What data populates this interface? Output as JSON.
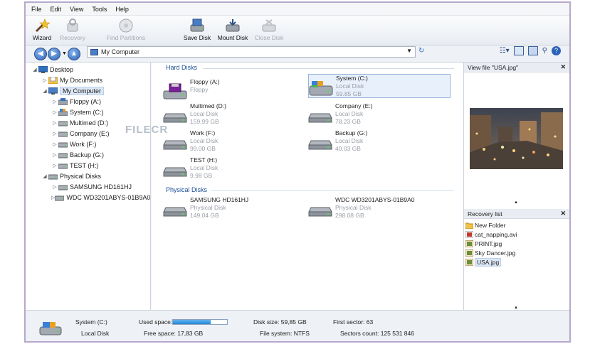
{
  "menu": [
    "File",
    "Edit",
    "View",
    "Tools",
    "Help"
  ],
  "toolbar": {
    "wizard": "Wizard",
    "recovery": "Recovery",
    "find_partitions": "Find Partitions",
    "save_disk": "Save Disk",
    "mount_disk": "Mount Disk",
    "close_disk": "Close Disk"
  },
  "address": "My Computer",
  "tree": [
    {
      "label": "Desktop",
      "level": 0,
      "expanded": true,
      "icon": "desktop-icon"
    },
    {
      "label": "My Documents",
      "level": 1,
      "expanded": false,
      "icon": "documents-icon"
    },
    {
      "label": "My Computer",
      "level": 1,
      "expanded": true,
      "icon": "computer-icon",
      "selected": true
    },
    {
      "label": "Floppy (A:)",
      "level": 2,
      "expanded": false,
      "icon": "floppy-icon"
    },
    {
      "label": "System (C:)",
      "level": 2,
      "expanded": false,
      "icon": "system-drive-icon"
    },
    {
      "label": "Multimed (D:)",
      "level": 2,
      "expanded": false,
      "icon": "drive-icon"
    },
    {
      "label": "Company (E:)",
      "level": 2,
      "expanded": false,
      "icon": "drive-icon"
    },
    {
      "label": "Work (F:)",
      "level": 2,
      "expanded": false,
      "icon": "drive-icon"
    },
    {
      "label": "Backup (G:)",
      "level": 2,
      "expanded": false,
      "icon": "drive-icon"
    },
    {
      "label": "TEST (H:)",
      "level": 2,
      "expanded": false,
      "icon": "drive-icon"
    },
    {
      "label": "Physical Disks",
      "level": 1,
      "expanded": true,
      "icon": "drive-icon"
    },
    {
      "label": "SAMSUNG HD161HJ",
      "level": 2,
      "expanded": false,
      "icon": "drive-icon"
    },
    {
      "label": "WDC WD3201ABYS-01B9A0",
      "level": 2,
      "expanded": false,
      "icon": "drive-icon"
    }
  ],
  "hard_disks_header": "Hard Disks",
  "physical_disks_header": "Physical Disks",
  "hard_disks": [
    {
      "name": "Floppy (A:)",
      "type": "Floppy",
      "size": ""
    },
    {
      "name": "System (C:)",
      "type": "Local Disk",
      "size": "59.85 GB",
      "selected": true
    },
    {
      "name": "Multimed (D:)",
      "type": "Local Disk",
      "size": "159.99 GB"
    },
    {
      "name": "Company (E:)",
      "type": "Local Disk",
      "size": "78.23 GB"
    },
    {
      "name": "Work (F:)",
      "type": "Local Disk",
      "size": "99.00 GB"
    },
    {
      "name": "Backup (G:)",
      "type": "Local Disk",
      "size": "40.03 GB"
    },
    {
      "name": "TEST (H:)",
      "type": "Local Disk",
      "size": "9.98 GB"
    }
  ],
  "physical_disks": [
    {
      "name": "SAMSUNG HD161HJ",
      "type": "Physical Disk",
      "size": "149.04 GB"
    },
    {
      "name": "WDC WD3201ABYS-01B9A0",
      "type": "Physical Disk",
      "size": "298.08 GB"
    }
  ],
  "view_panel_title": "View file \"USA.jpg\"",
  "recovery_panel_title": "Recovery list",
  "recovery_list": [
    {
      "name": "New Folder",
      "icon": "folder-icon"
    },
    {
      "name": "cat_napping.avi",
      "icon": "video-file-icon"
    },
    {
      "name": "PRINT.jpg",
      "icon": "image-file-icon"
    },
    {
      "name": "Sky Dancer.jpg",
      "icon": "image-file-icon"
    },
    {
      "name": "USA.jpg",
      "icon": "image-file-icon",
      "selected": true
    }
  ],
  "status": {
    "disk_name": "System (C:)",
    "disk_type": "Local Disk",
    "used_space_label": "Used space:",
    "used_fraction": 0.7,
    "free_space": "Free space: 17,83 GB",
    "disk_size": "Disk size: 59,85 GB",
    "file_system": "File system: NTFS",
    "first_sector": "First sector: 63",
    "sectors_count": "Sectors count: 125 531 846"
  },
  "watermark": "FILECR",
  "colors": {
    "accent": "#2586d6",
    "group_header": "#1a4e96",
    "selection": "#dde8f6"
  }
}
